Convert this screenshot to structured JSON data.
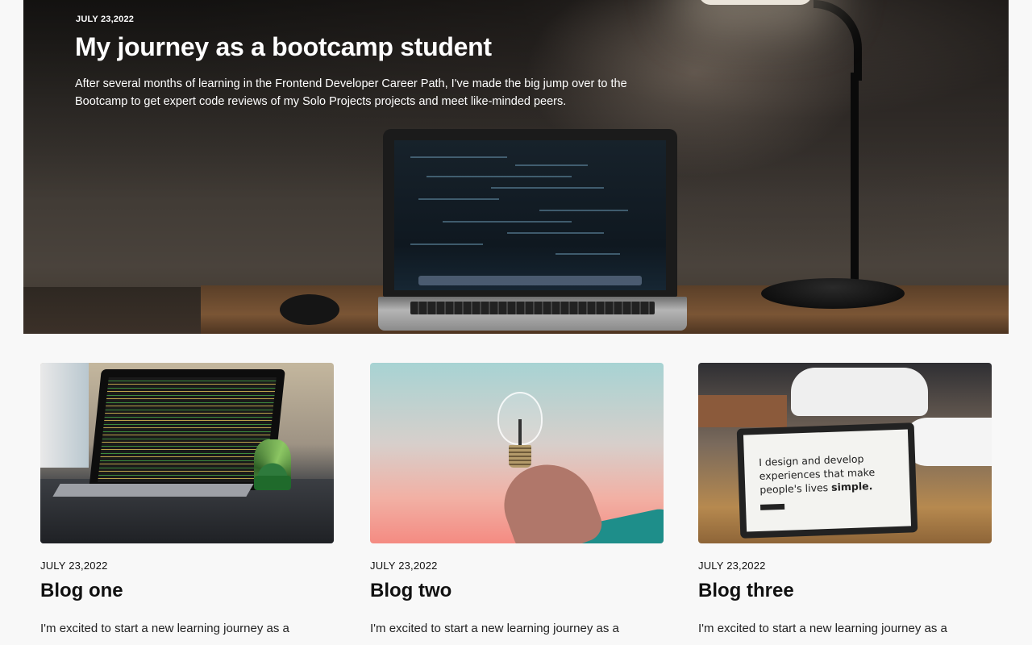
{
  "hero": {
    "date": "JULY 23,2022",
    "title": "My journey as a bootcamp student",
    "text_line1": "After several months of learning in the Frontend Developer Career Path, I've made the big jump over to the",
    "text_line2": "Bootcamp to get expert code reviews of my Solo Projects projects and meet like-minded peers."
  },
  "posts": [
    {
      "date": "JULY 23,2022",
      "title": "Blog one",
      "excerpt": "I'm excited to start a new learning journey as a"
    },
    {
      "date": "JULY 23,2022",
      "title": "Blog two",
      "excerpt": "I'm excited to start a new learning journey as a"
    },
    {
      "date": "JULY 23,2022",
      "title": "Blog three",
      "excerpt": "I'm excited to start a new learning journey as a",
      "image_screen_text_1": "I design and develop",
      "image_screen_text_2": "experiences that make",
      "image_screen_text_3": "people's lives ",
      "image_screen_text_bold": "simple."
    }
  ]
}
